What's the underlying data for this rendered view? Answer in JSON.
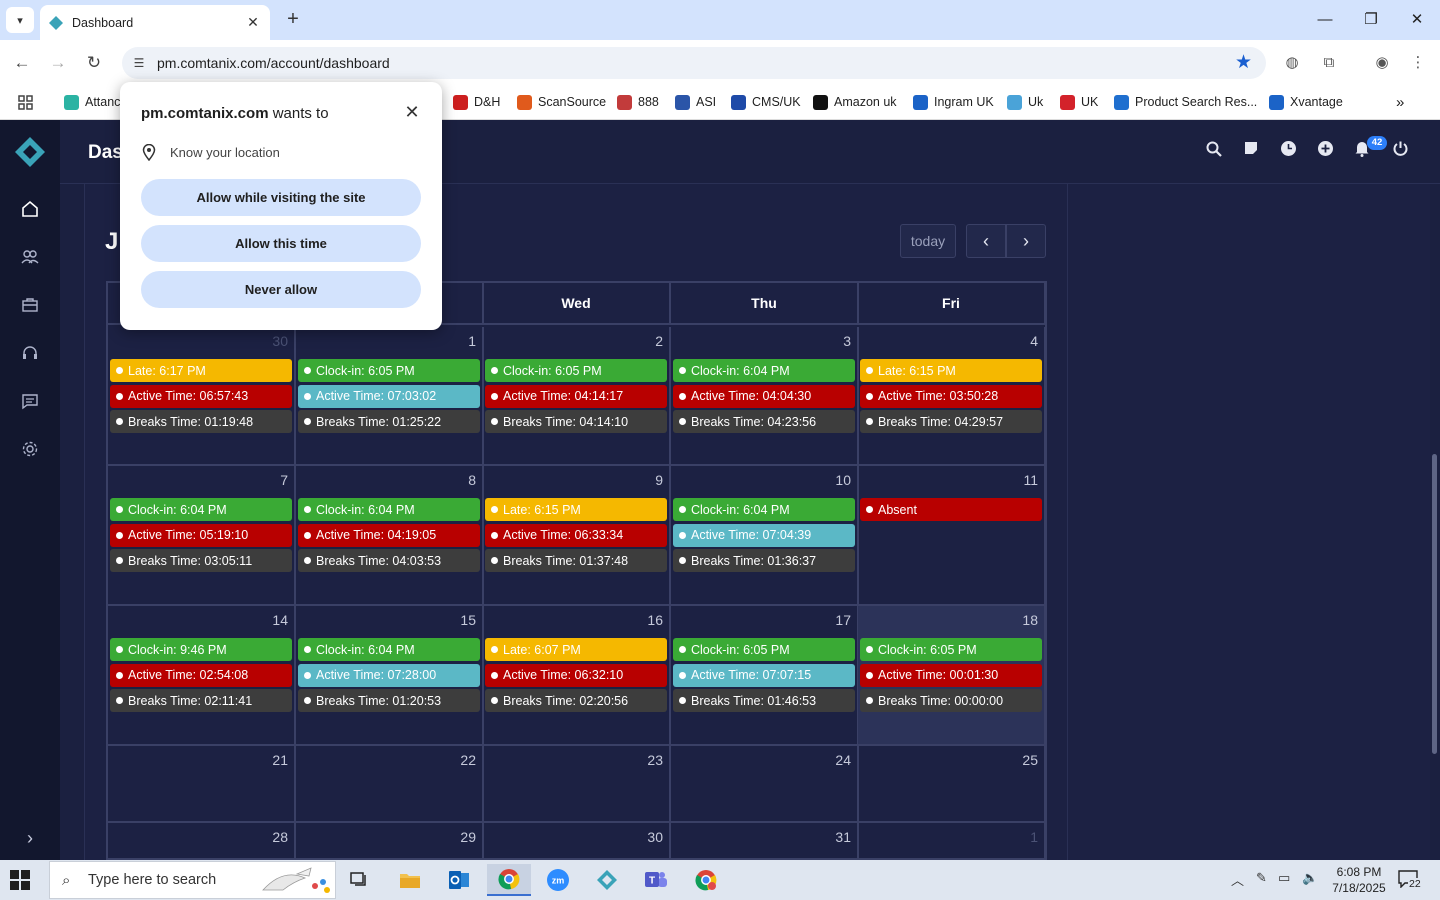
{
  "browser": {
    "tab_title": "Dashboard",
    "url": "pm.comtanix.com/account/dashboard",
    "bookmarks": [
      {
        "label": "Attanc",
        "color": "#2bb3a3"
      },
      {
        "label": "D&H",
        "color": "#cc1f1f"
      },
      {
        "label": "ScanSource",
        "color": "#e05a1c"
      },
      {
        "label": "888",
        "color": "#c23b3b"
      },
      {
        "label": "ASI",
        "color": "#2b55a8"
      },
      {
        "label": "CMS/UK",
        "color": "#1e4aa8"
      },
      {
        "label": "Amazon uk",
        "color": "#111111"
      },
      {
        "label": "Ingram UK",
        "color": "#1b63c7"
      },
      {
        "label": "Uk",
        "color": "#4aa3d8"
      },
      {
        "label": "UK",
        "color": "#d3222a"
      },
      {
        "label": "Product Search Res...",
        "color": "#1f6fcf"
      },
      {
        "label": "Xvantage",
        "color": "#1b63c7"
      }
    ]
  },
  "popup": {
    "site": "pm.comtanix.com",
    "wants_to": " wants to",
    "permission": "Know your location",
    "buttons": [
      "Allow while visiting the site",
      "Allow this time",
      "Never allow"
    ]
  },
  "app": {
    "page_title": "Das",
    "month_title": "J",
    "notification_count": "42",
    "today_label": "today"
  },
  "calendar": {
    "headers": [
      "",
      "",
      "Wed",
      "Thu",
      "Fri"
    ],
    "weeks": [
      [
        {
          "day": "30",
          "other": true,
          "events": [
            {
              "type": "late",
              "text": "Late: 6:17 PM"
            },
            {
              "type": "active",
              "text": "Active Time: 06:57:43"
            },
            {
              "type": "breaks",
              "text": "Breaks Time: 01:19:48"
            }
          ]
        },
        {
          "day": "1",
          "events": [
            {
              "type": "clockin",
              "text": "Clock-in: 6:05 PM"
            },
            {
              "type": "activegood",
              "text": "Active Time: 07:03:02"
            },
            {
              "type": "breaks",
              "text": "Breaks Time: 01:25:22"
            }
          ]
        },
        {
          "day": "2",
          "events": [
            {
              "type": "clockin",
              "text": "Clock-in: 6:05 PM"
            },
            {
              "type": "active",
              "text": "Active Time: 04:14:17"
            },
            {
              "type": "breaks",
              "text": "Breaks Time: 04:14:10"
            }
          ]
        },
        {
          "day": "3",
          "events": [
            {
              "type": "clockin",
              "text": "Clock-in: 6:04 PM"
            },
            {
              "type": "active",
              "text": "Active Time: 04:04:30"
            },
            {
              "type": "breaks",
              "text": "Breaks Time: 04:23:56"
            }
          ]
        },
        {
          "day": "4",
          "events": [
            {
              "type": "late",
              "text": "Late: 6:15 PM"
            },
            {
              "type": "active",
              "text": "Active Time: 03:50:28"
            },
            {
              "type": "breaks",
              "text": "Breaks Time: 04:29:57"
            }
          ]
        }
      ],
      [
        {
          "day": "7",
          "events": [
            {
              "type": "clockin",
              "text": "Clock-in: 6:04 PM"
            },
            {
              "type": "active",
              "text": "Active Time: 05:19:10"
            },
            {
              "type": "breaks",
              "text": "Breaks Time: 03:05:11"
            }
          ]
        },
        {
          "day": "8",
          "events": [
            {
              "type": "clockin",
              "text": "Clock-in: 6:04 PM"
            },
            {
              "type": "active",
              "text": "Active Time: 04:19:05"
            },
            {
              "type": "breaks",
              "text": "Breaks Time: 04:03:53"
            }
          ]
        },
        {
          "day": "9",
          "events": [
            {
              "type": "late",
              "text": "Late: 6:15 PM"
            },
            {
              "type": "active",
              "text": "Active Time: 06:33:34"
            },
            {
              "type": "breaks",
              "text": "Breaks Time: 01:37:48"
            }
          ]
        },
        {
          "day": "10",
          "events": [
            {
              "type": "clockin",
              "text": "Clock-in: 6:04 PM"
            },
            {
              "type": "activegood",
              "text": "Active Time: 07:04:39"
            },
            {
              "type": "breaks",
              "text": "Breaks Time: 01:36:37"
            }
          ]
        },
        {
          "day": "11",
          "events": [
            {
              "type": "absent",
              "text": "Absent"
            }
          ]
        }
      ],
      [
        {
          "day": "14",
          "events": [
            {
              "type": "clockin",
              "text": "Clock-in: 9:46 PM"
            },
            {
              "type": "active",
              "text": "Active Time: 02:54:08"
            },
            {
              "type": "breaks",
              "text": "Breaks Time: 02:11:41"
            }
          ]
        },
        {
          "day": "15",
          "events": [
            {
              "type": "clockin",
              "text": "Clock-in: 6:04 PM"
            },
            {
              "type": "activegood",
              "text": "Active Time: 07:28:00"
            },
            {
              "type": "breaks",
              "text": "Breaks Time: 01:20:53"
            }
          ]
        },
        {
          "day": "16",
          "events": [
            {
              "type": "late",
              "text": "Late: 6:07 PM"
            },
            {
              "type": "active",
              "text": "Active Time: 06:32:10"
            },
            {
              "type": "breaks",
              "text": "Breaks Time: 02:20:56"
            }
          ]
        },
        {
          "day": "17",
          "events": [
            {
              "type": "clockin",
              "text": "Clock-in: 6:05 PM"
            },
            {
              "type": "activegood",
              "text": "Active Time: 07:07:15"
            },
            {
              "type": "breaks",
              "text": "Breaks Time: 01:46:53"
            }
          ]
        },
        {
          "day": "18",
          "today": true,
          "events": [
            {
              "type": "clockin",
              "text": "Clock-in: 6:05 PM"
            },
            {
              "type": "active",
              "text": "Active Time: 00:01:30"
            },
            {
              "type": "breaks",
              "text": "Breaks Time: 00:00:00"
            }
          ]
        }
      ],
      [
        {
          "day": "21",
          "events": []
        },
        {
          "day": "22",
          "events": []
        },
        {
          "day": "23",
          "events": []
        },
        {
          "day": "24",
          "events": []
        },
        {
          "day": "25",
          "events": []
        }
      ],
      [
        {
          "day": "28",
          "events": []
        },
        {
          "day": "29",
          "events": []
        },
        {
          "day": "30",
          "events": []
        },
        {
          "day": "31",
          "events": []
        },
        {
          "day": "1",
          "other": true,
          "events": []
        }
      ]
    ]
  },
  "event_colors": {
    "late": {
      "bg": "#f5b800",
      "fg": "#ffffff"
    },
    "clockin": {
      "bg": "#3aaa35",
      "fg": "#ffffff"
    },
    "active": {
      "bg": "#b80000",
      "fg": "#ffffff"
    },
    "activegood": {
      "bg": "#5bb8c6",
      "fg": "#ffffff"
    },
    "breaks": {
      "bg": "#3d3d3d",
      "fg": "#ffffff"
    },
    "absent": {
      "bg": "#b80000",
      "fg": "#ffffff"
    }
  },
  "taskbar": {
    "search_placeholder": "Type here to search",
    "time": "6:08 PM",
    "date": "7/18/2025",
    "notification_count": "22"
  }
}
